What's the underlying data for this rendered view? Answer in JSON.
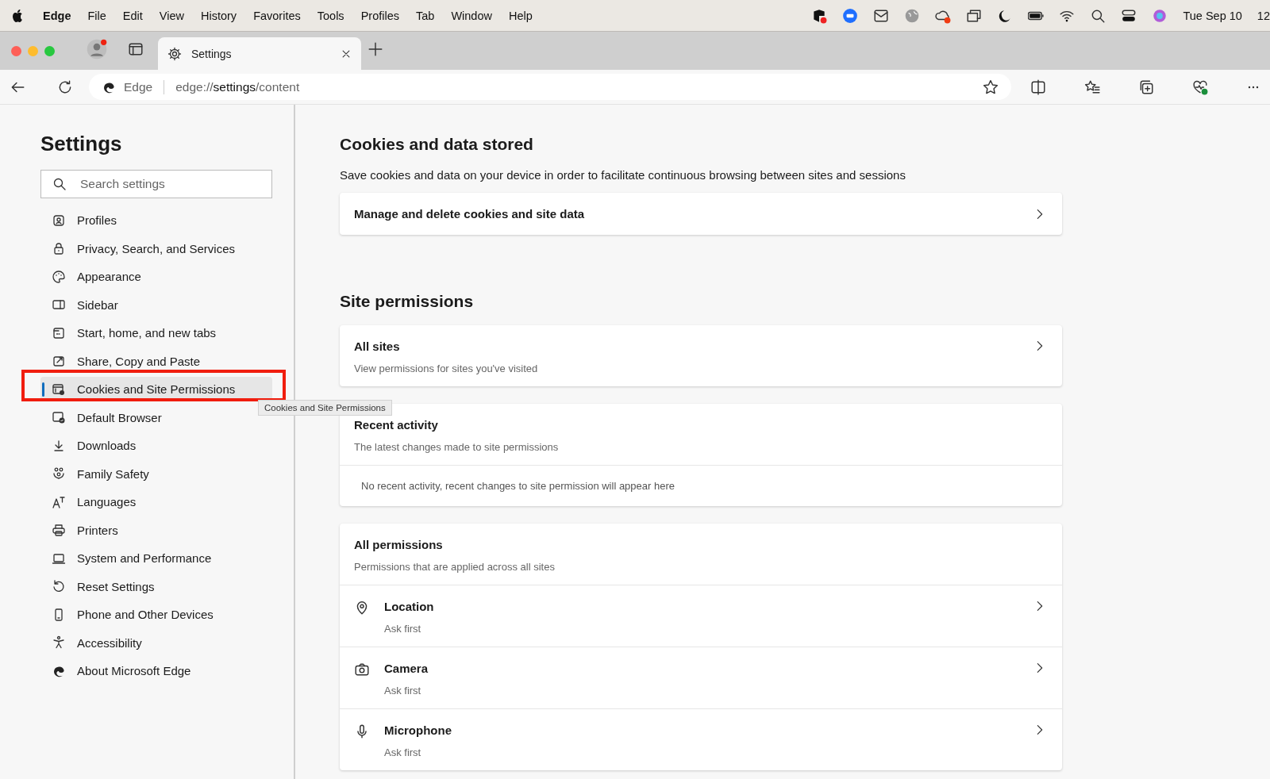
{
  "menu_bar": {
    "app_name": "Edge",
    "menus": [
      "File",
      "Edit",
      "View",
      "History",
      "Favorites",
      "Tools",
      "Profiles",
      "Tab",
      "Window",
      "Help"
    ],
    "clock": [
      "Tue Sep 10",
      "12"
    ]
  },
  "tab": {
    "title": "Settings"
  },
  "address_bar": {
    "site_label": "Edge",
    "url": "edge://**settings**/content"
  },
  "sidebar": {
    "title": "Settings",
    "search": {
      "placeholder": "Search settings"
    },
    "items": [
      {
        "label": "Profiles",
        "selected": false
      },
      {
        "label": "Privacy, Search, and Services",
        "selected": false
      },
      {
        "label": "Appearance",
        "selected": false
      },
      {
        "label": "Sidebar",
        "selected": false
      },
      {
        "label": "Start, home, and new tabs",
        "selected": false
      },
      {
        "label": "Share, Copy and Paste",
        "selected": false
      },
      {
        "label": "Cookies and Site Permissions",
        "selected": true
      },
      {
        "label": "Default Browser",
        "selected": false
      },
      {
        "label": "Downloads",
        "selected": false
      },
      {
        "label": "Family Safety",
        "selected": false
      },
      {
        "label": "Languages",
        "selected": false
      },
      {
        "label": "Printers",
        "selected": false
      },
      {
        "label": "System and Performance",
        "selected": false
      },
      {
        "label": "Reset Settings",
        "selected": false
      },
      {
        "label": "Phone and Other Devices",
        "selected": false
      },
      {
        "label": "Accessibility",
        "selected": false
      },
      {
        "label": "About Microsoft Edge",
        "selected": false
      }
    ]
  },
  "tooltip": {
    "text": "Cookies and Site Permissions"
  },
  "content": {
    "cookies": {
      "title": "Cookies and data stored",
      "description": "Save cookies and data on your device in order to facilitate continuous browsing between sites and sessions",
      "link": "Manage and delete cookies and site data"
    },
    "site_permissions": {
      "title": "Site permissions",
      "all_sites": {
        "title": "All sites",
        "subtitle": "View permissions for sites you've visited"
      },
      "recent_activity": {
        "title": "Recent activity",
        "subtitle": "The latest changes made to site permissions",
        "empty": "No recent activity, recent changes to site permission will appear here"
      },
      "all_permissions": {
        "title": "All permissions",
        "subtitle": "Permissions that are applied across all sites",
        "items": [
          {
            "label": "Location",
            "status": "Ask first"
          },
          {
            "label": "Camera",
            "status": "Ask first"
          },
          {
            "label": "Microphone",
            "status": "Ask first"
          }
        ]
      }
    }
  }
}
